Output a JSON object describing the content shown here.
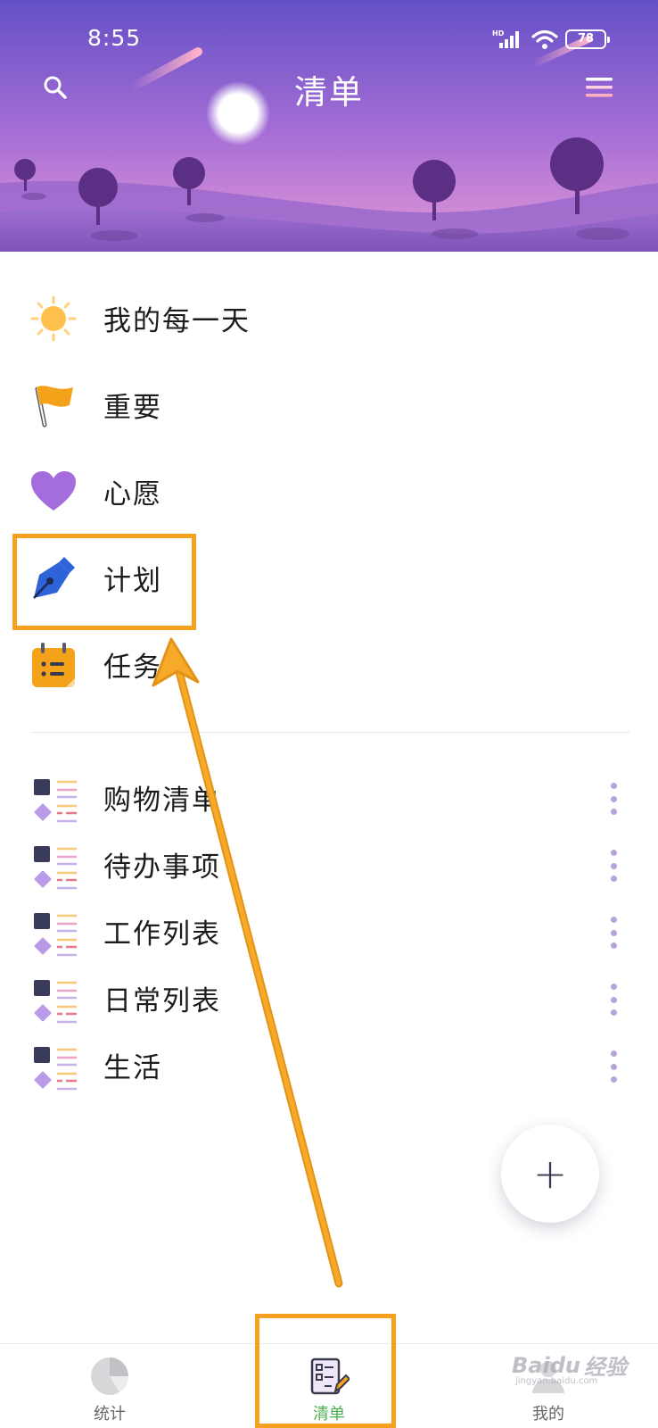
{
  "status_bar": {
    "time": "8:55",
    "network": "HD",
    "battery": "78"
  },
  "header": {
    "title": "清单",
    "search_icon": "search-icon",
    "menu_icon": "menu-icon"
  },
  "smart_lists": [
    {
      "label": "我的每一天",
      "icon": "sun-icon"
    },
    {
      "label": "重要",
      "icon": "flag-icon"
    },
    {
      "label": "心愿",
      "icon": "heart-icon"
    },
    {
      "label": "计划",
      "icon": "pen-nib-icon"
    },
    {
      "label": "任务",
      "icon": "calendar-icon"
    }
  ],
  "custom_lists": [
    {
      "label": "购物清单"
    },
    {
      "label": "待办事项"
    },
    {
      "label": "工作列表"
    },
    {
      "label": "日常列表"
    },
    {
      "label": "生活"
    }
  ],
  "fab": {
    "label": "+"
  },
  "bottom_nav": [
    {
      "label": "统计",
      "icon": "pie-chart-icon",
      "active": false
    },
    {
      "label": "清单",
      "icon": "checklist-icon",
      "active": true
    },
    {
      "label": "我的",
      "icon": "profile-icon",
      "active": false
    }
  ],
  "watermark": {
    "brand": "Baidu",
    "suffix": "经验",
    "sub": "jingyan.baidu.com"
  },
  "colors": {
    "header_top": "#6a51c9",
    "header_bottom": "#c682d6",
    "highlight": "#f5a01f",
    "active_nav": "#4caf50",
    "more_dots": "#b8a3dd"
  }
}
